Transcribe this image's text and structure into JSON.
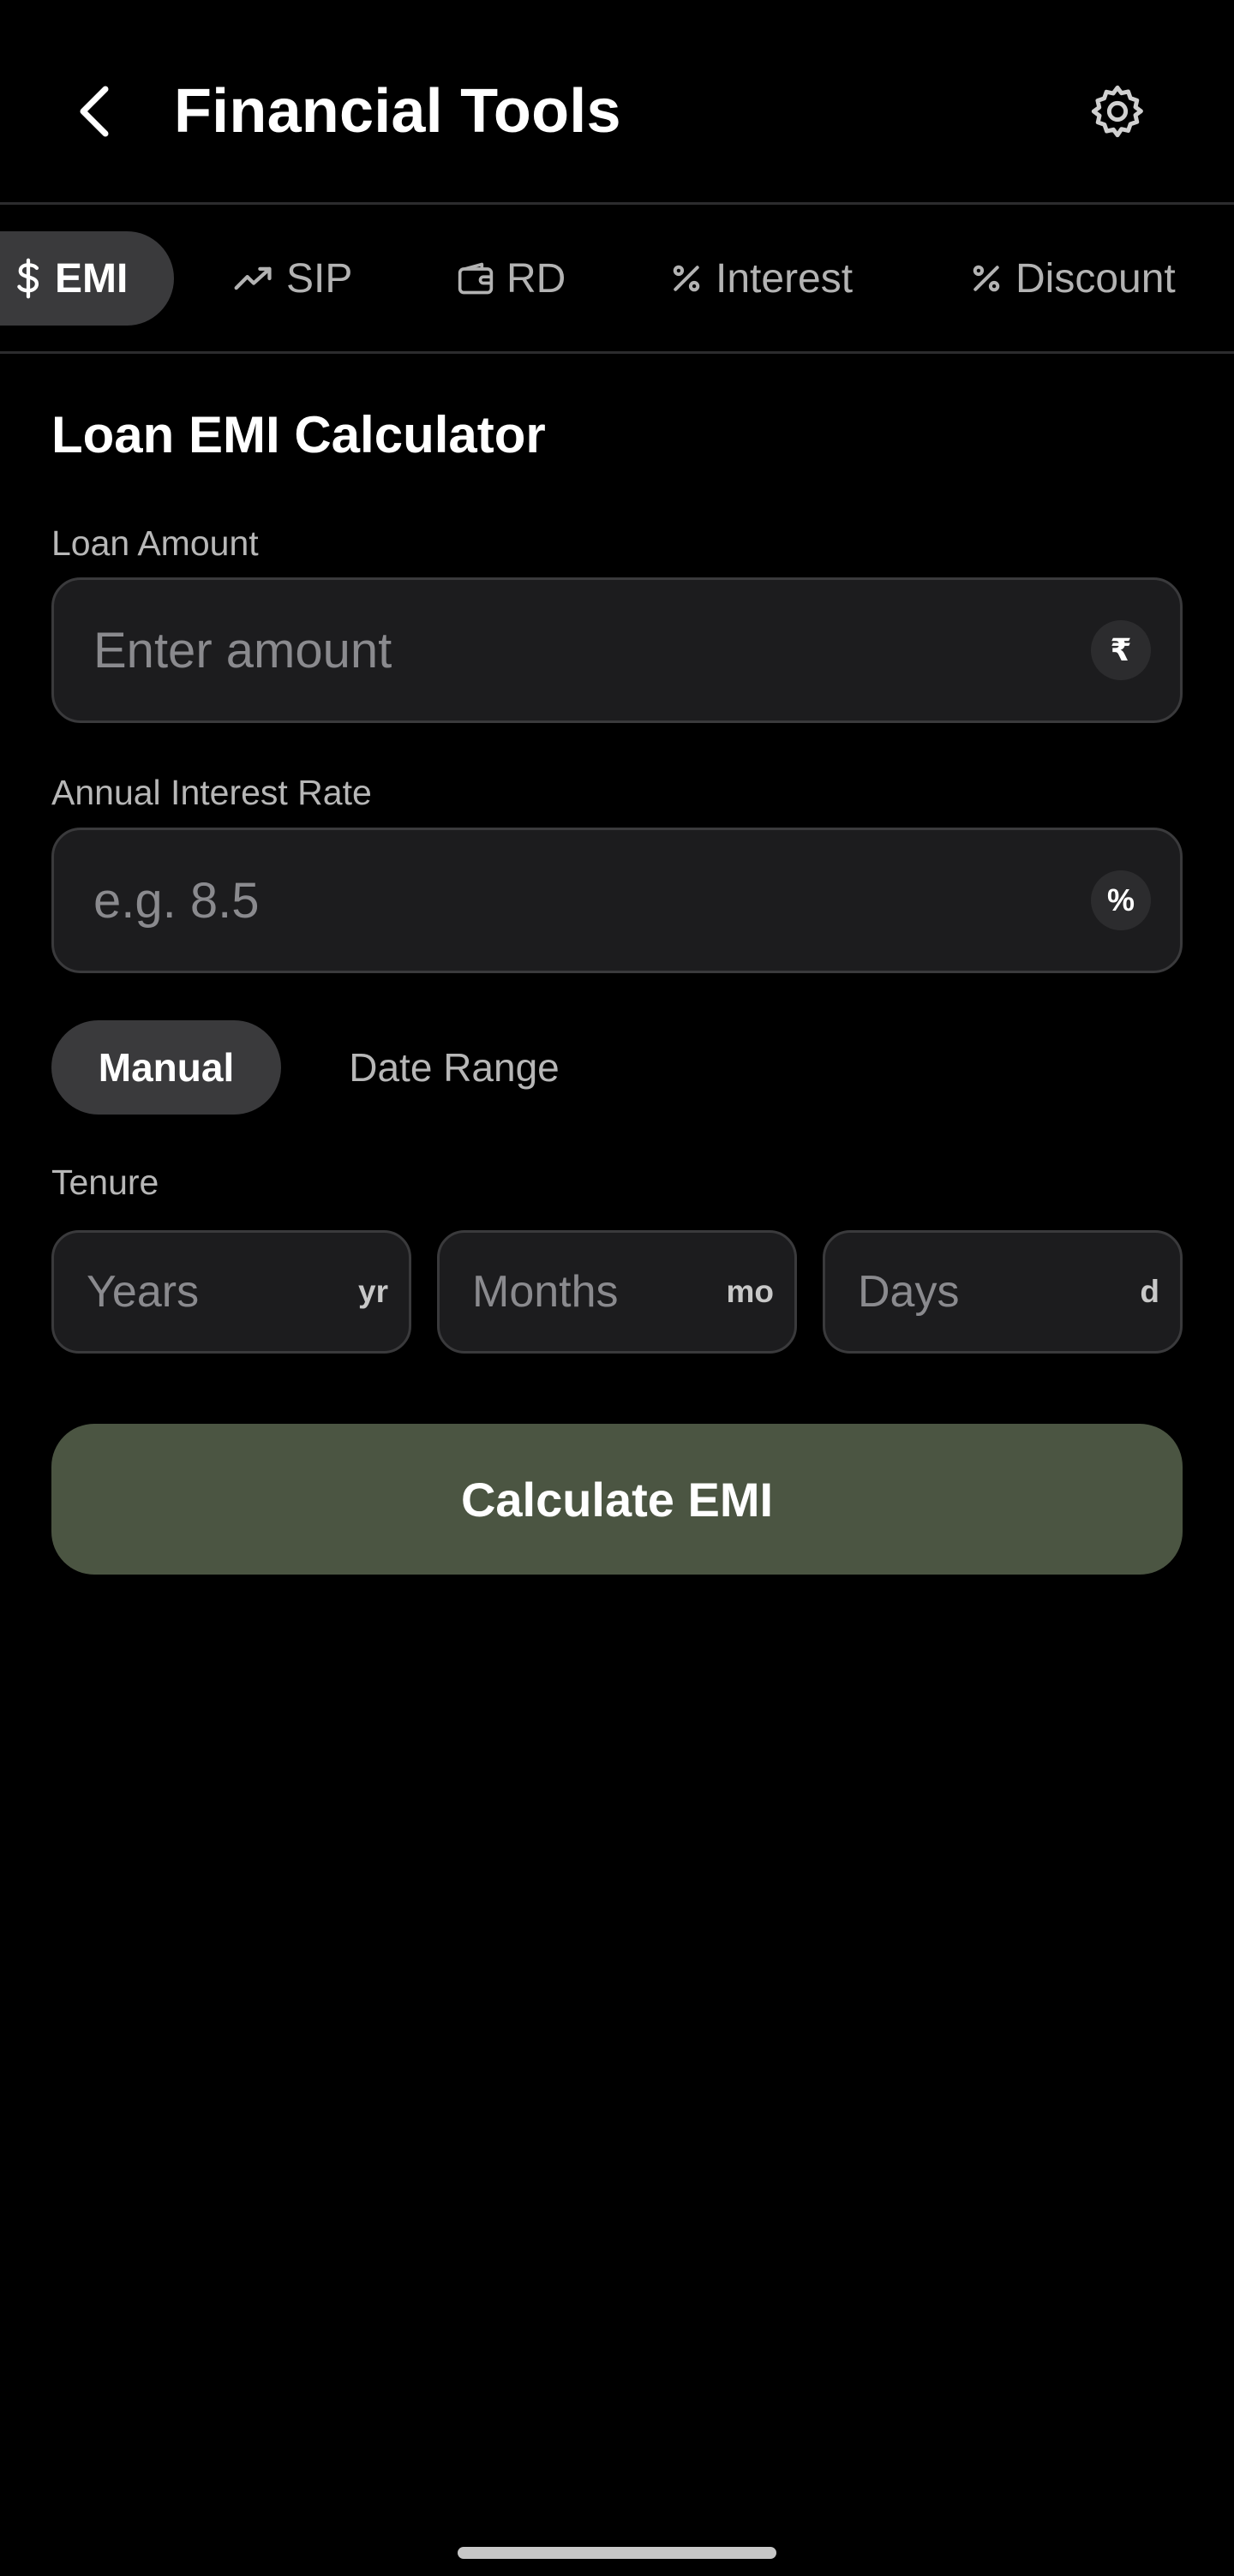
{
  "header": {
    "title": "Financial Tools",
    "back_icon": "chevron-left-icon",
    "settings_icon": "gear-icon"
  },
  "tabs": [
    {
      "label": "EMI",
      "icon": "dollar-icon",
      "active": true
    },
    {
      "label": "SIP",
      "icon": "trending-up-icon",
      "active": false
    },
    {
      "label": "RD",
      "icon": "wallet-icon",
      "active": false
    },
    {
      "label": "Interest",
      "icon": "percent-icon",
      "active": false
    },
    {
      "label": "Discount",
      "icon": "percent-icon",
      "active": false
    }
  ],
  "calculator": {
    "title": "Loan EMI Calculator",
    "loan_amount": {
      "label": "Loan Amount",
      "placeholder": "Enter amount",
      "value": "",
      "adornment": "₹"
    },
    "interest_rate": {
      "label": "Annual Interest Rate",
      "placeholder": "e.g. 8.5",
      "value": "",
      "adornment": "%"
    },
    "mode": {
      "selected": "Manual",
      "options": [
        "Manual",
        "Date Range"
      ]
    },
    "tenure": {
      "label": "Tenure",
      "years": {
        "placeholder": "Years",
        "unit": "yr",
        "value": ""
      },
      "months": {
        "placeholder": "Months",
        "unit": "mo",
        "value": ""
      },
      "days": {
        "placeholder": "Days",
        "unit": "d",
        "value": ""
      }
    },
    "button_label": "Calculate EMI"
  },
  "colors": {
    "background": "#000000",
    "input_background": "#1c1c1e",
    "active_pill": "#3a3a3c",
    "primary_button": "#4b5542"
  }
}
